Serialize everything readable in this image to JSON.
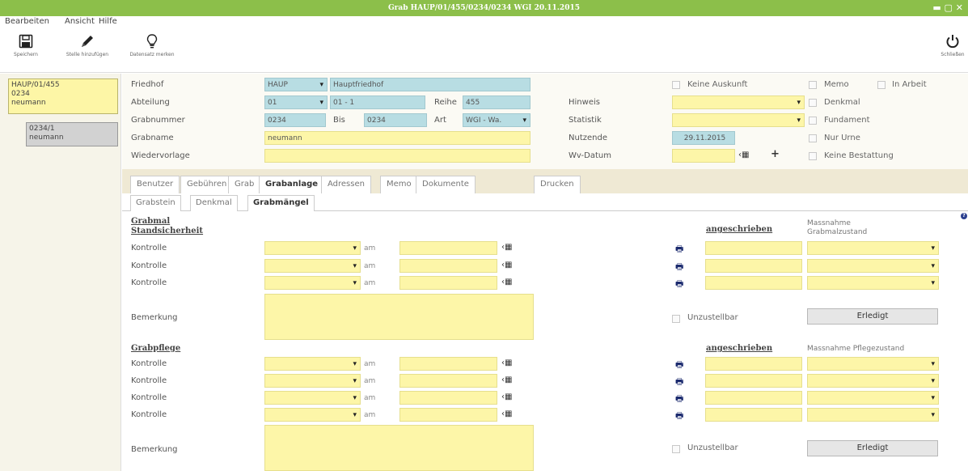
{
  "window": {
    "title": "Grab HAUP/01/455/0234/0234 WGI 20.11.2015",
    "controls": "▬ ▢ ✕"
  },
  "menu": [
    "Bearbeiten",
    "Ansicht",
    "Hilfe"
  ],
  "toolbar": {
    "save": "Speichern",
    "add_place": "Stelle hinzufügen",
    "mark_record": "Datensatz merken",
    "close": "Schließen"
  },
  "tree": {
    "grave": [
      "HAUP/01/455",
      "0234",
      "neumann"
    ],
    "child": [
      "0234/1",
      "neumann"
    ]
  },
  "header": {
    "friedhof": {
      "label": "Friedhof",
      "code": "HAUP",
      "name": "Hauptfriedhof"
    },
    "abteilung": {
      "label": "Abteilung",
      "code": "01",
      "name": "01 - 1"
    },
    "reihe": {
      "label": "Reihe",
      "value": "455"
    },
    "grabnummer": {
      "label": "Grabnummer",
      "value": "0234"
    },
    "bis": {
      "label": "Bis",
      "value": "0234"
    },
    "art": {
      "label": "Art",
      "value": "WGI - Wa."
    },
    "grabname": {
      "label": "Grabname",
      "value": "neumann"
    },
    "wiedervorlage": {
      "label": "Wiedervorlage",
      "value": ""
    },
    "hinweis": {
      "label": "Hinweis",
      "value": ""
    },
    "statistik": {
      "label": "Statistik",
      "value": ""
    },
    "nutzende": {
      "label": "Nutzende",
      "value": "29.11.2015"
    },
    "wvdatum": {
      "label": "Wv-Datum",
      "value": ""
    },
    "flags": {
      "keine_auskunft": "Keine Auskunft",
      "memo": "Memo",
      "in_arbeit": "In Arbeit",
      "denkmal": "Denkmal",
      "fundament": "Fundament",
      "nur_urne": "Nur Urne",
      "keine_bestattung": "Keine Bestattung"
    }
  },
  "tabs": [
    "Benutzer",
    "Gebühren",
    "Grab",
    "Grabanlage",
    "Adressen",
    "Memo",
    "Dokumente",
    "Drucken"
  ],
  "subtabs": [
    "Grabstein",
    "Denkmal",
    "Grabmängel"
  ],
  "standsicherheit": {
    "title": "Grabmal Standsicherheit",
    "angeschrieben": "angeschrieben",
    "massnahme": "Massnahme Grabmalzustand",
    "kontrolle_label": "Kontrolle",
    "am_label": "am",
    "bemerkung": "Bemerkung",
    "unzustellbar": "Unzustellbar",
    "erledigt": "Erledigt"
  },
  "grabpflege": {
    "title": "Grabpflege",
    "angeschrieben": "angeschrieben",
    "massnahme": "Massnahme Pflegezustand",
    "kontrolle_label": "Kontrolle",
    "am_label": "am",
    "bemerkung": "Bemerkung",
    "unzustellbar": "Unzustellbar",
    "erledigt": "Erledigt"
  },
  "colors": {
    "titlebar": "#8cbf4a",
    "field_blue": "#b8dde3",
    "field_yellow": "#fdf6a8",
    "tree_selected": "#fdf6a6"
  }
}
